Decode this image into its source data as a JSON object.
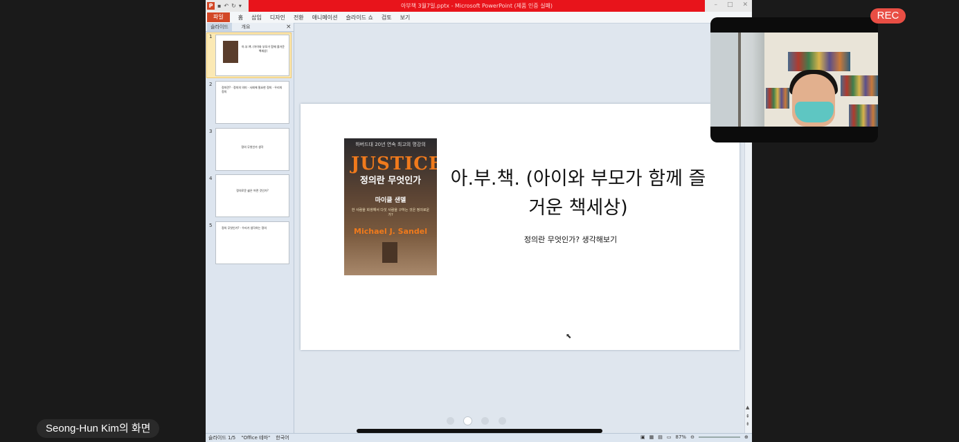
{
  "window": {
    "title": "아부책 3월7일.pptx - Microsoft PowerPoint (제품 인증 실패)"
  },
  "ribbon": {
    "file_label": "파일",
    "tabs": [
      "홈",
      "삽입",
      "디자인",
      "전환",
      "애니메이션",
      "슬라이드 쇼",
      "검토",
      "보기"
    ]
  },
  "panel": {
    "tab_slides": "슬라이드",
    "tab_outline": "개요",
    "close": "×",
    "thumbnails": [
      {
        "num": "1",
        "text": "아.부.책. (아이와 부모가 함께 즐거운 책세상)"
      },
      {
        "num": "2",
        "text": "정의란? · 정의의 의미 · 사회에 필요한 정의 · 우리의 정의"
      },
      {
        "num": "3",
        "text": "정의 무엇인가 생각"
      },
      {
        "num": "4",
        "text": "정의로운 삶은 어떤 것인가?"
      },
      {
        "num": "5",
        "text": "정의 무엇인가? · 우리가 생각하는 정의"
      }
    ]
  },
  "slide": {
    "title": "아.부.책. (아이와 부모가 함께 즐거운 책세상)",
    "subtitle": "정의란 무엇인가? 생각해보기",
    "book": {
      "top": "하버드대 20년 연속 최고의 명강의",
      "brand": "JUSTICE",
      "title_kr": "정의란 무엇인가",
      "author_kr": "마이클 샌델",
      "blurb": "한 사람을 희생해서 다섯 사람을 구하는 것은 정의로운가?",
      "author_en": "Michael J. Sandel"
    }
  },
  "status": {
    "slide_counter": "슬라이드 1/5",
    "theme": "\"Office 테마\"",
    "language": "한국어",
    "zoom": "87%"
  },
  "overlay": {
    "rec_label": "REC",
    "presenter_label": "Seong-Hun Kim의 화면",
    "page_dots": {
      "count": 4,
      "active": 1
    }
  }
}
